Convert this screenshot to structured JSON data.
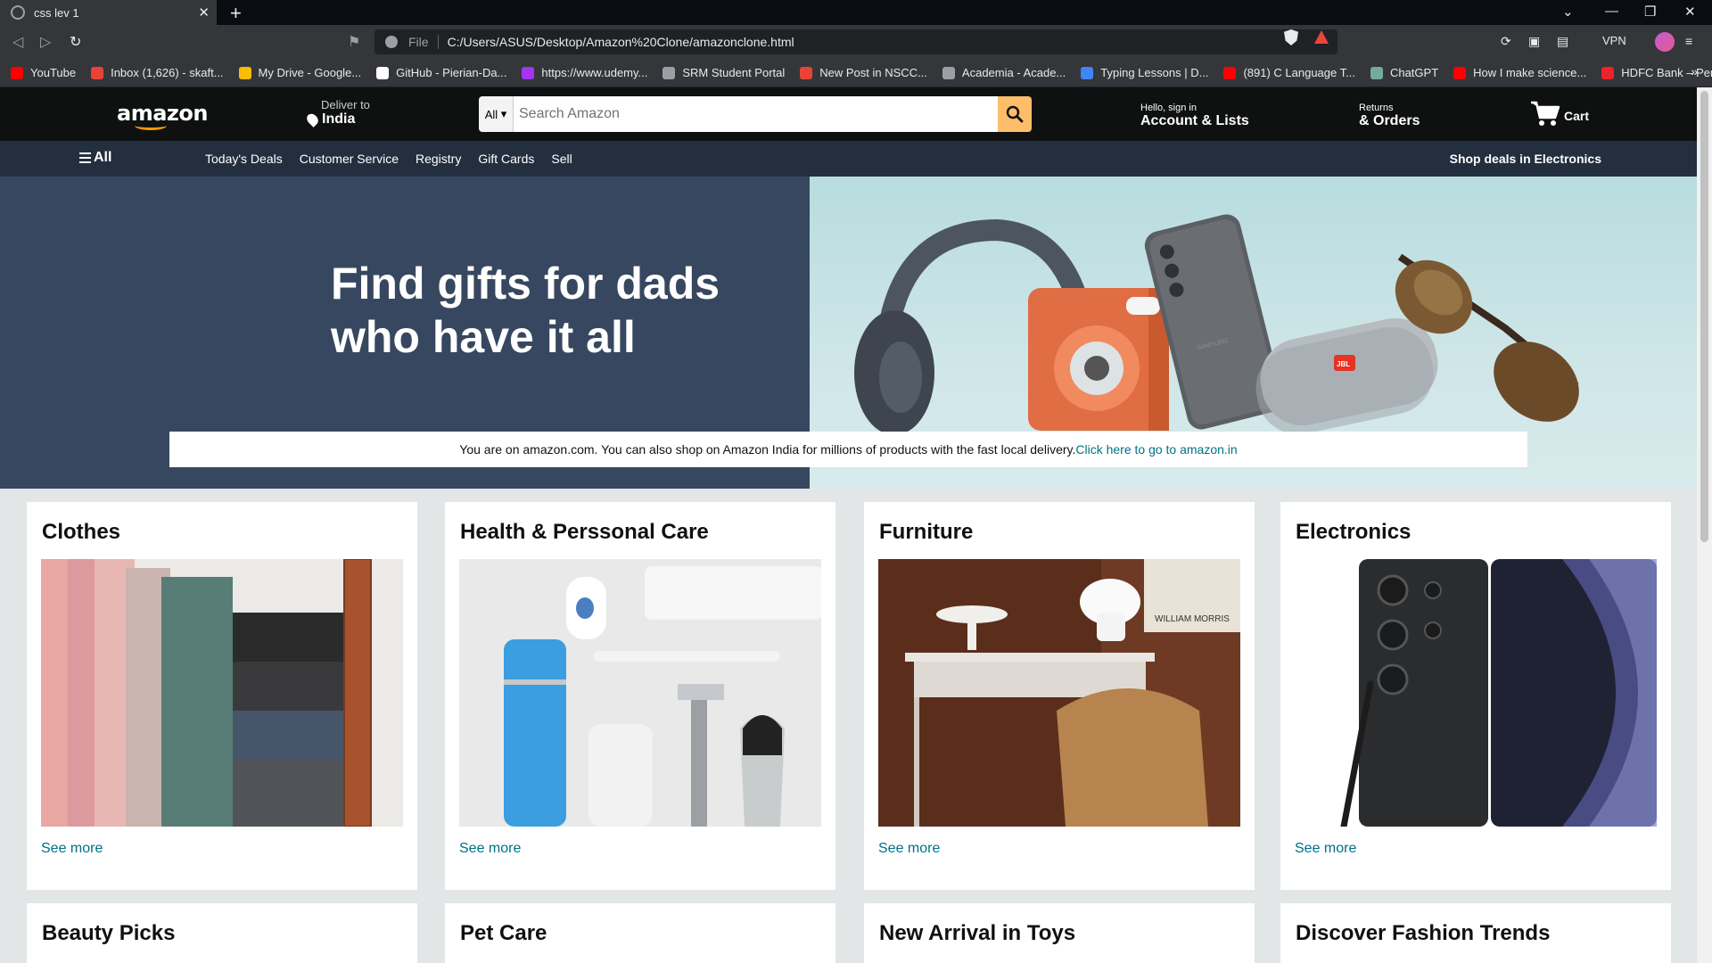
{
  "browser": {
    "tab_title": "css lev 1",
    "url_scheme": "File",
    "url": "C:/Users/ASUS/Desktop/Amazon%20Clone/amazonclone.html",
    "vpn_label": "VPN",
    "bookmarks": [
      {
        "label": "YouTube",
        "color": "#ff0000"
      },
      {
        "label": "Inbox (1,626) - skaft...",
        "color": "#ea4335"
      },
      {
        "label": "My Drive - Google...",
        "color": "#fbbc04"
      },
      {
        "label": "GitHub - Pierian-Da...",
        "color": "#ffffff"
      },
      {
        "label": "https://www.udemy...",
        "color": "#a435f0"
      },
      {
        "label": "SRM Student Portal",
        "color": "#9aa0a6"
      },
      {
        "label": "New Post in NSCC...",
        "color": "#ea4335"
      },
      {
        "label": "Academia - Acade...",
        "color": "#9aa0a6"
      },
      {
        "label": "Typing Lessons | D...",
        "color": "#4285f4"
      },
      {
        "label": "(891) C Language T...",
        "color": "#ff0000"
      },
      {
        "label": "ChatGPT",
        "color": "#74aa9c"
      },
      {
        "label": "How I make science...",
        "color": "#ff0000"
      },
      {
        "label": "HDFC Bank – Perso...",
        "color": "#ed232a"
      }
    ]
  },
  "amazon": {
    "logo": "amazon",
    "deliver_small": "Deliver to",
    "deliver_big": "India",
    "search_category": "All",
    "search_placeholder": "Search Amazon",
    "signin_small": "Hello, sign in",
    "signin_big": "Account & Lists",
    "returns_small": "Returns",
    "returns_big": "& Orders",
    "cart_label": "Cart",
    "all_label": "All",
    "sub_links": [
      "Today's Deals",
      "Customer Service",
      "Registry",
      "Gift Cards",
      "Sell"
    ],
    "shop_deals": "Shop deals in Electronics",
    "hero_title": "Find gifts for dads who have it all",
    "notice_text": "You are on amazon.com. You can also shop on Amazon India for millions of products with the fast local delivery.",
    "notice_link": "Click here to go to amazon.in",
    "cards": [
      {
        "title": "Clothes",
        "link": "See more"
      },
      {
        "title": "Health & Perssonal Care",
        "link": "See more"
      },
      {
        "title": "Furniture",
        "link": "See more"
      },
      {
        "title": "Electronics",
        "link": "See more"
      }
    ],
    "cards_row2": [
      {
        "title": "Beauty Picks"
      },
      {
        "title": "Pet Care"
      },
      {
        "title": "New Arrival in Toys"
      },
      {
        "title": "Discover Fashion Trends"
      }
    ],
    "product_labels": {
      "furniture_poster": "WILLIAM MORRIS",
      "speaker_brand": "JBL",
      "phone_brand": "SAMSUNG"
    }
  }
}
